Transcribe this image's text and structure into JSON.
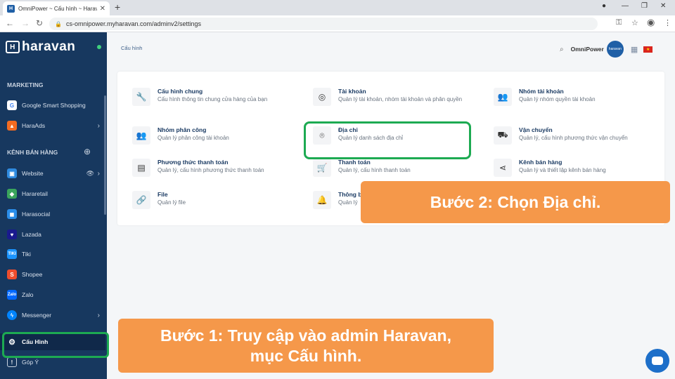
{
  "browser": {
    "tab_title": "OmniPower ~ Cấu hình ~ Harav",
    "tab_favicon": "H",
    "url": "cs-omnipower.myharavan.com/adminv2/settings"
  },
  "sidebar": {
    "logo_text": "haravan",
    "sections": {
      "marketing": "MARKETING",
      "channels": "KÊNH BÁN HÀNG"
    },
    "items": [
      {
        "label": "Google Smart Shopping",
        "icon": "google-icon",
        "color": "#ffffff"
      },
      {
        "label": "HaraAds",
        "icon": "haraads-icon",
        "color": "#f26b21"
      },
      {
        "label": "Website",
        "icon": "website-icon",
        "color": "#2f8be0"
      },
      {
        "label": "Hararetail",
        "icon": "hararetail-icon",
        "color": "#3aa55c"
      },
      {
        "label": "Harasocial",
        "icon": "harasocial-icon",
        "color": "#2a8de9"
      },
      {
        "label": "Lazada",
        "icon": "lazada-icon",
        "color": "#1a1a8e"
      },
      {
        "label": "Tiki",
        "icon": "tiki-icon",
        "color": "#1a94ff"
      },
      {
        "label": "Shopee",
        "icon": "shopee-icon",
        "color": "#ee4d2d"
      },
      {
        "label": "Zalo",
        "icon": "zalo-icon",
        "color": "#0068ff"
      },
      {
        "label": "Messenger",
        "icon": "messenger-icon",
        "color": "#0084ff"
      },
      {
        "label": "Cấu Hình",
        "icon": "gear-icon",
        "color": "#10294a"
      },
      {
        "label": "Góp Ý",
        "icon": "feedback-icon",
        "color": "#17385f"
      }
    ]
  },
  "header": {
    "breadcrumb": "Cấu hình",
    "store_name": "OmniPower",
    "avatar_text": "haravan"
  },
  "settings": [
    {
      "title": "Cấu hình chung",
      "desc": "Cấu hình thông tin chung cửa hàng của bạn",
      "icon": "wrench-icon"
    },
    {
      "title": "Tài khoản",
      "desc": "Quản lý tài khoản, nhóm tài khoản và phân quyền",
      "icon": "account-icon"
    },
    {
      "title": "Nhóm tài khoản",
      "desc": "Quản lý nhóm quyền tài khoản",
      "icon": "group-icon"
    },
    {
      "title": "Nhóm phân công",
      "desc": "Quản lý phân công tài khoản",
      "icon": "team-icon"
    },
    {
      "title": "Địa chỉ",
      "desc": "Quản lý danh sách địa chỉ",
      "icon": "location-icon"
    },
    {
      "title": "Vận chuyển",
      "desc": "Quản lý, cấu hình phương thức vận chuyển",
      "icon": "truck-icon"
    },
    {
      "title": "Phương thức thanh toán",
      "desc": "Quản lý, cấu hình phương thức thanh toán",
      "icon": "payment-icon"
    },
    {
      "title": "Thanh toán",
      "desc": "Quản lý, cấu hình thanh toán",
      "icon": "cart-icon"
    },
    {
      "title": "Kênh bán hàng",
      "desc": "Quản lý và thiết lập kênh bán hàng",
      "icon": "share-icon"
    },
    {
      "title": "File",
      "desc": "Quản lý file",
      "icon": "link-icon"
    },
    {
      "title": "Thông b",
      "desc": "Quản lý",
      "icon": "bell-icon"
    }
  ],
  "callouts": {
    "step1_line1": "Bước 1: Truy cập vào admin Haravan,",
    "step1_line2": "mục Cấu hình.",
    "step2": "Bước 2: Chọn Địa chỉ."
  },
  "colors": {
    "sidebar_bg": "#17385f",
    "highlight": "#1daa52",
    "callout": "#f5984a"
  }
}
